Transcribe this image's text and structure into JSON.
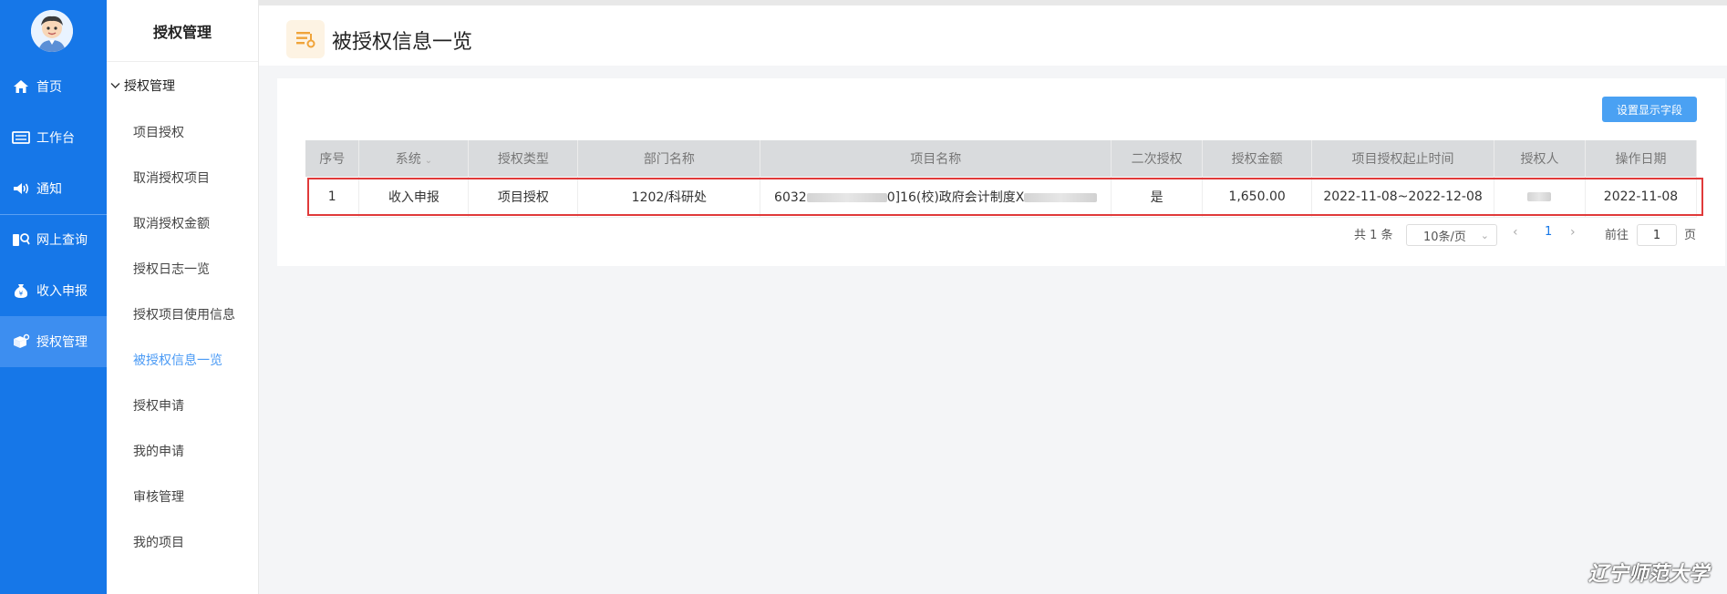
{
  "rail": {
    "items": [
      {
        "label": "首页",
        "icon": "home-icon"
      },
      {
        "label": "工作台",
        "icon": "workbench-icon"
      },
      {
        "label": "通知",
        "icon": "speaker-icon"
      },
      {
        "label": "网上查询",
        "icon": "query-icon"
      },
      {
        "label": "收入申报",
        "icon": "money-bag-icon"
      },
      {
        "label": "授权管理",
        "icon": "authorize-icon"
      }
    ],
    "active": "授权管理"
  },
  "submenu": {
    "title": "授权管理",
    "group_title": "授权管理",
    "items": [
      "项目授权",
      "取消授权项目",
      "取消授权金额",
      "授权日志一览",
      "授权项目使用信息",
      "被授权信息一览",
      "授权申请",
      "我的申请",
      "审核管理",
      "我的项目"
    ],
    "active": "被授权信息一览"
  },
  "header": {
    "title": "被授权信息一览"
  },
  "toolbar": {
    "set_fields_label": "设置显示字段"
  },
  "table": {
    "columns": [
      "序号",
      "系统",
      "授权类型",
      "部门名称",
      "项目名称",
      "二次授权",
      "授权金额",
      "项目授权起止时间",
      "授权人",
      "操作日期"
    ],
    "rows": [
      {
        "index": "1",
        "system": "收入申报",
        "auth_type": "项目授权",
        "department": "1202/科研处",
        "project_prefix": "6032",
        "project_middle": "0]16(校)政府会计制度",
        "project_suffix": "X",
        "secondary": "是",
        "amount": "1,650.00",
        "period": "2022-11-08~2022-12-08",
        "authorizer": "",
        "op_date": "2022-11-08"
      }
    ]
  },
  "pagination": {
    "total_text": "共 1 条",
    "page_size": "10条/页",
    "current_page": "1",
    "goto_label": "前往",
    "goto_value": "1",
    "page_suffix": "页"
  },
  "watermark": "辽宁师范大学",
  "colors": {
    "rail": "#1677e8",
    "active_text": "#4a9af5",
    "button": "#4aa1f3",
    "highlight": "#e03a3a"
  }
}
